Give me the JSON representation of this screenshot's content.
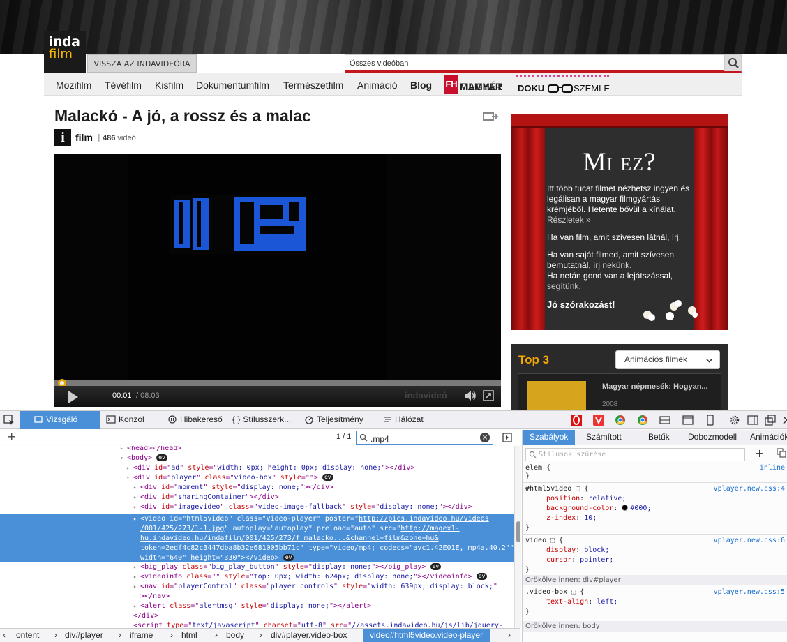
{
  "site": {
    "logo_top": "inda",
    "logo_bottom": "film",
    "back_link": "VISSZA AZ INDAVIDEÓRA",
    "search_placeholder": "Összes videóban",
    "nav": [
      "Mozifilm",
      "Tévéfilm",
      "Kisfilm",
      "Dokumentumfilm",
      "Természetfilm",
      "Animáció",
      "Blog"
    ],
    "magyar_fh": "FH",
    "magyar_line1": "MAGYAR",
    "magyar_line2": "FILMHÉT",
    "doku_left": "DOKU",
    "doku_right": "SZEMLE"
  },
  "video": {
    "title": "Malackó - A jó, a rossz és a malac",
    "channel_initial": "i",
    "channel": "film",
    "sep": "|",
    "count": "486",
    "count_suffix": " videó",
    "time_current": "00:01",
    "time_total": "/ 08:03",
    "watermark": "indavideó",
    "progress_fraction": 0.002
  },
  "promo": {
    "title": "Mi ez?",
    "p1": "Itt több tucat filmet nézhetsz ingyen és legálisan a magyar filmgyártás krémjéből. Hetente bővül a kínálat.",
    "p1_link": "Részletek »",
    "p2": "Ha van film, amit szívesen látnál,",
    "p2_link": "írj.",
    "p3": "Ha van saját filmed, amit szívesen bemutatnál,",
    "p3_link": "írj nekünk.",
    "p4": "Ha netán gond van a lejátszással,",
    "p4_link": "segítünk.",
    "closing": "Jó szórakozást!"
  },
  "top3": {
    "title": "Top 3",
    "select": "Animációs filmek",
    "item_name": "Magyar népmesék: Hogyan...",
    "item_year": "2008"
  },
  "devtools": {
    "tabs": [
      "Vizsgáló",
      "Konzol",
      "Hibakereső",
      "Stílusszerk...",
      "Teljesítmény",
      "Hálózat"
    ],
    "match": "1 / 1",
    "search_value": ".mp4",
    "tree": {
      "head_line": "<head></head>",
      "body_open": "<body>",
      "div_ad": [
        "<div ",
        "id",
        "=\"",
        "ad",
        "\" ",
        "style",
        "=\"",
        "width: 0px; height: 0px; display: none;",
        "\"></div>"
      ],
      "player_open": [
        "<div ",
        "id",
        "=\"",
        "player",
        "\" ",
        "class",
        "=\"",
        "video-box",
        "\" ",
        "style",
        "=\"\">"
      ],
      "moment": [
        "<div ",
        "id",
        "=\"",
        "moment",
        "\" ",
        "style",
        "=\"",
        "display: none;",
        "\"></div>"
      ],
      "sharing": [
        "<div ",
        "id",
        "=\"",
        "sharingContainer",
        "\"></div>"
      ],
      "imagevideo": [
        "<div ",
        "id",
        "=\"",
        "imagevideo",
        "\" ",
        "class",
        "=\"",
        "video-image-fallback",
        "\" ",
        "style",
        "=\"",
        "display: none;",
        "\"></div>"
      ],
      "video_l1a": "<video id=\"html5video\" class=\"video-player\" poster=\"",
      "video_l1b": "http://pics.indavideo.hu/videos",
      "video_l2a": "/001/425/273/1-1.jpg",
      "video_l2b": "\" autoplay=\"autoplay\" preload=\"auto\" src=\"",
      "video_l2c": "http://magex1-",
      "video_l3": "hu.indavideo.hu/indafilm/001/425/273/f_malacko...&channel=film&zone=hu&",
      "video_l4a": "token=2edf4c82c3447dba8b32e681005bb71c",
      "video_l4b": "\" type=\"video/mp4; codecs=\"avc1.42E01E, mp4a.40.2\"\"",
      "video_l5": "width=\"640\" height=\"330\"></video>",
      "bigplay": [
        "<big_play ",
        "class",
        "=\"",
        "big_play_button",
        "\" ",
        "style",
        "=\"",
        "display: none;",
        "\"></big_play>"
      ],
      "videoinfo": [
        "<videoinfo ",
        "class",
        "=\"\" ",
        "style",
        "=\"",
        "top: 0px; width: 624px; display: none;",
        "\"></videoinfo>"
      ],
      "nav": [
        "<nav ",
        "id",
        "=\"",
        "playerControl",
        "\" ",
        "class",
        "=\"",
        "player_controls",
        "\" ",
        "style",
        "=\"",
        "width: 639px; display: block;",
        "\""
      ],
      "nav_close": "></nav>",
      "alert": [
        "<alert ",
        "class",
        "=\"",
        "alertmsg",
        "\" ",
        "style",
        "=\"",
        "display: none;",
        "\"></alert>"
      ],
      "div_close": "</div>",
      "script": [
        "<script ",
        "type",
        "=\"",
        "text/javascript",
        "\" ",
        "charset",
        "=\"",
        "utf-8",
        "\" ",
        "src",
        "=\"",
        "//assets.indavideo.hu/js/lib/jquery-"
      ],
      "ev": "ev"
    },
    "breadcrumbs": [
      "ontent",
      "div#player",
      "iframe",
      "html",
      "body",
      "div#player.video-box",
      "video#html5video.video-player"
    ],
    "rtabs": [
      "Szabályok",
      "Számított",
      "Betűk",
      "Dobozmodell",
      "Animációk"
    ],
    "filter_placeholder": "Stílusok szűrése",
    "rules": {
      "elem_sel": "elem {",
      "elem_src": "inline",
      "r1_sel": "#html5video",
      "r1_src": "vplayer.new.css:4",
      "r1_p1n": "position",
      "r1_p1v": "relative;",
      "r1_p2n": "background-color",
      "r1_p2v": "#000;",
      "r1_p3n": "z-index",
      "r1_p3v": "10;",
      "r2_sel": "video",
      "r2_src": "vplayer.new.css:6",
      "r2_p1n": "display",
      "r2_p1v": "block;",
      "r2_p2n": "cursor",
      "r2_p2v": "pointer;",
      "inh1": "Örökölve innen: div#player",
      "r3_sel": ".video-box",
      "r3_src": "vplayer.new.css:5",
      "r3_p1n": "text-align",
      "r3_p1v": "left;",
      "inh2": "Örökölve innen: body",
      "brace_open": "{",
      "brace_close": "}"
    }
  },
  "colors": {
    "accent_red": "#c4161c",
    "devtools_blue": "#4a90d9",
    "gold": "#f6a800"
  }
}
